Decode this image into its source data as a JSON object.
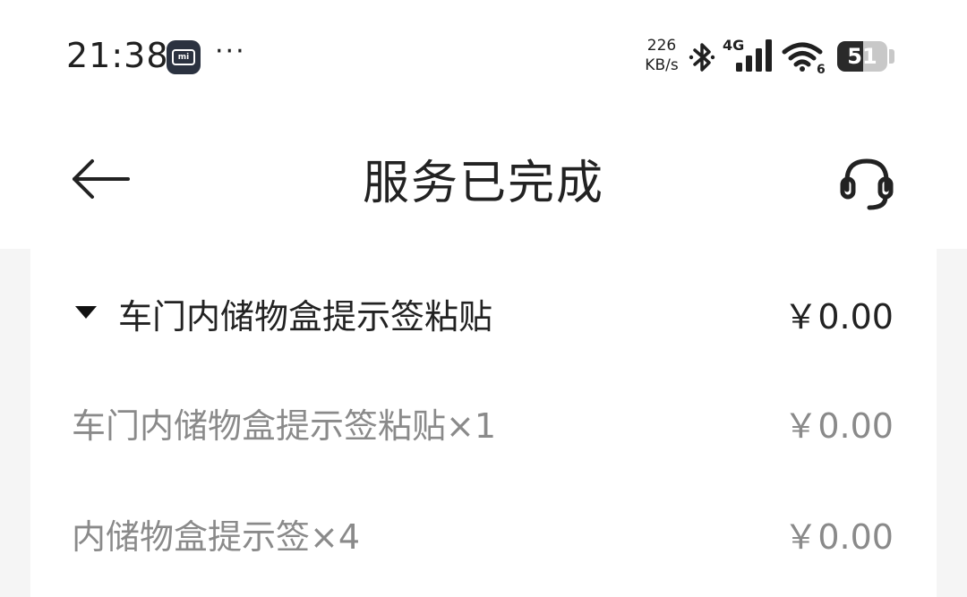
{
  "status_bar": {
    "time": "21:38",
    "more_dots": "···",
    "net_speed_value": "226",
    "net_speed_unit": "KB/s",
    "network_type": "4G",
    "wifi_label": "6",
    "battery_level": "51"
  },
  "header": {
    "title": "服务已完成"
  },
  "order": {
    "group": {
      "label": "车门内储物盒提示签粘贴",
      "price": "￥0.00"
    },
    "items": [
      {
        "label": "车门内储物盒提示签粘贴×1",
        "price": "￥0.00"
      },
      {
        "label": "内储物盒提示签×4",
        "price": "￥0.00"
      }
    ]
  },
  "icons": {
    "app": "mi-app-icon",
    "bluetooth": "bluetooth-icon",
    "signal": "signal-icon",
    "wifi": "wifi-icon",
    "battery": "battery-icon",
    "back": "back-arrow-icon",
    "support": "headset-icon",
    "expand": "caret-down-icon"
  }
}
